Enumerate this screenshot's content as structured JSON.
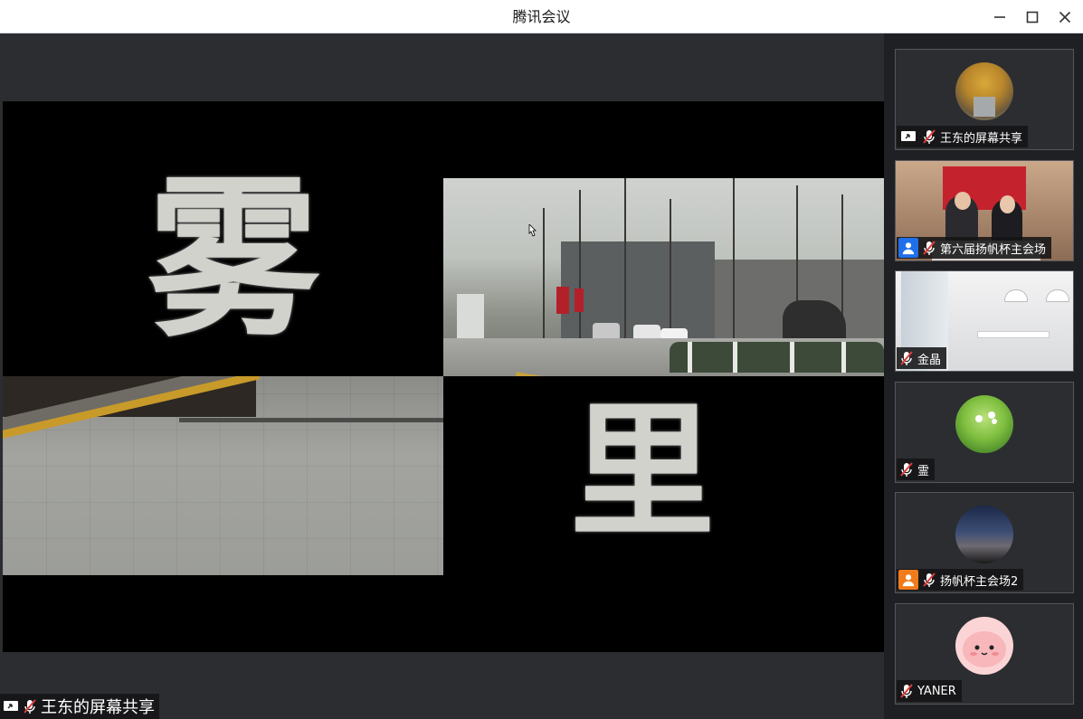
{
  "window": {
    "title": "腾讯会议",
    "controls": {
      "minimize_icon": "minimize-icon",
      "maximize_icon": "maximize-icon",
      "close_icon": "close-icon"
    }
  },
  "share": {
    "presenter_label": "王东的屏幕共享",
    "calligraphy_top": "雾",
    "calligraphy_bottom": "里"
  },
  "participants": [
    {
      "name": "王东的屏幕共享",
      "role": "screen-share",
      "muted": true,
      "avatar": "tree-photo"
    },
    {
      "name": "第六届扬帆杯主会场",
      "role": "host-blue",
      "muted": true,
      "avatar": "video-stage"
    },
    {
      "name": "金晶",
      "role": "none",
      "muted": true,
      "avatar": "video-room"
    },
    {
      "name": "霊",
      "role": "none",
      "muted": true,
      "avatar": "grass-photo"
    },
    {
      "name": "扬帆杯主会场2",
      "role": "cohost-orange",
      "muted": true,
      "avatar": "sky-photo"
    },
    {
      "name": "YANER",
      "role": "none",
      "muted": true,
      "avatar": "pink-cartoon"
    }
  ],
  "colors": {
    "host_blue": "#1f6feb",
    "cohost_orange": "#f07b1b",
    "stage_bg": "#2b2d30",
    "sidebar_bg": "#1f2023"
  }
}
